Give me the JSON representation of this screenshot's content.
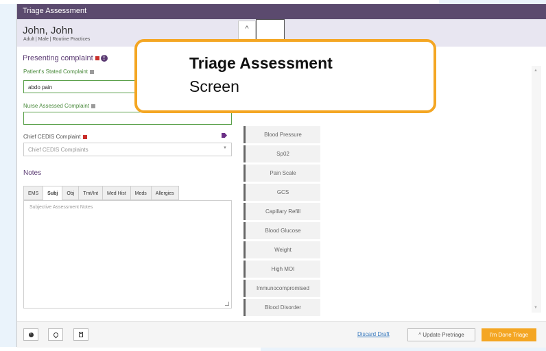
{
  "window": {
    "title": "Triage Assessment"
  },
  "patient": {
    "name": "John, John",
    "meta": "Adult | Male | Routine Practices"
  },
  "collapse_caret": "^",
  "presenting": {
    "title": "Presenting complaint",
    "stated_label": "Patient's Stated Complaint",
    "stated_value": "abdo pain",
    "nurse_label": "Nurse Assessed Complaint",
    "nurse_value": "",
    "cedis_label": "Chief CEDIS Complaint",
    "cedis_placeholder": "Chief CEDIS Complaints"
  },
  "notes": {
    "title": "Notes",
    "tabs": [
      {
        "label": "EMS"
      },
      {
        "label": "Subj"
      },
      {
        "label": "Obj"
      },
      {
        "label": "Tmt/Int"
      },
      {
        "label": "Med Hist"
      },
      {
        "label": "Meds"
      },
      {
        "label": "Allergies"
      }
    ],
    "active_tab": "Subj",
    "placeholder": "Subjective Assessment Notes"
  },
  "vitals": [
    {
      "label": "Blood Pressure"
    },
    {
      "label": "Sp02"
    },
    {
      "label": "Pain Scale"
    },
    {
      "label": "GCS"
    },
    {
      "label": "Capillary Refill"
    },
    {
      "label": "Blood Glucose"
    },
    {
      "label": "Weight"
    },
    {
      "label": "High MOI"
    },
    {
      "label": "Immunocompromised"
    },
    {
      "label": "Blood Disorder"
    }
  ],
  "footer": {
    "discard": "Discard Draft",
    "update": "Update Pretriage",
    "done": "I'm Done Triage"
  },
  "callout": {
    "line1": "Triage Assessment",
    "line2": "Screen"
  },
  "colors": {
    "header": "#5b4a6e",
    "accent": "#f4a623",
    "green": "#5aa04a",
    "purple": "#5b3b73"
  }
}
